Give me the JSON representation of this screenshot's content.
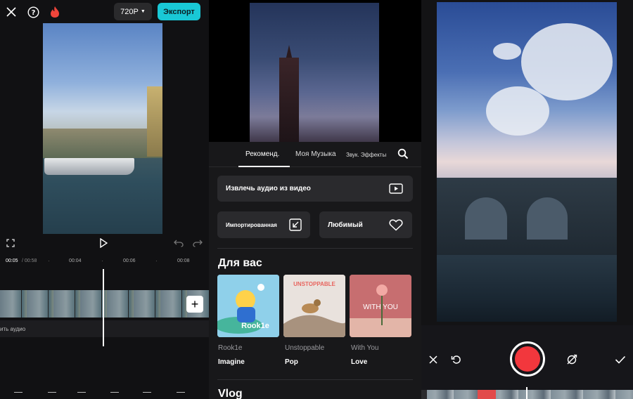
{
  "editor": {
    "resolution": "720P",
    "export_label": "Экспорт",
    "time_current": "00:05",
    "time_total": " / 00:58",
    "ticks": [
      "00:04",
      "00:06",
      "00:08"
    ],
    "add_clip": "+",
    "audio_track_label": "ить аудио"
  },
  "music": {
    "tabs": [
      "Рекоменд.",
      "Моя Музыка",
      "Звук. Эффекты"
    ],
    "active_tab": "Рекоменд.",
    "extract_audio": "Извлечь аудио из видео",
    "imported": "Импортированная",
    "favorites": "Любимый",
    "section_for_you": "Для вас",
    "section_vlog": "Vlog",
    "cards": [
      {
        "cover_text": "Rook1e",
        "artist": "Rook1e",
        "genre": "Imagine",
        "bg": "#8fd0ea"
      },
      {
        "cover_text": "UNSTOPPABLE",
        "artist": "Unstoppable",
        "genre": "Pop",
        "bg": "#e9e2dd"
      },
      {
        "cover_text": "WITH YOU",
        "artist": "With You",
        "genre": "Love",
        "bg": "#c76e70"
      }
    ]
  },
  "colors": {
    "accent": "#19c8d6",
    "record": "#f2373d",
    "panel_bg": "#18181a"
  },
  "icons": [
    "close-icon",
    "help-icon",
    "flame-icon",
    "chevron-down-icon",
    "fullscreen-icon",
    "play-icon",
    "undo-icon",
    "redo-icon",
    "search-icon",
    "play-box-icon",
    "import-arrow-icon",
    "heart-icon",
    "retake-icon",
    "record-icon",
    "flip-camera-icon",
    "check-icon"
  ]
}
